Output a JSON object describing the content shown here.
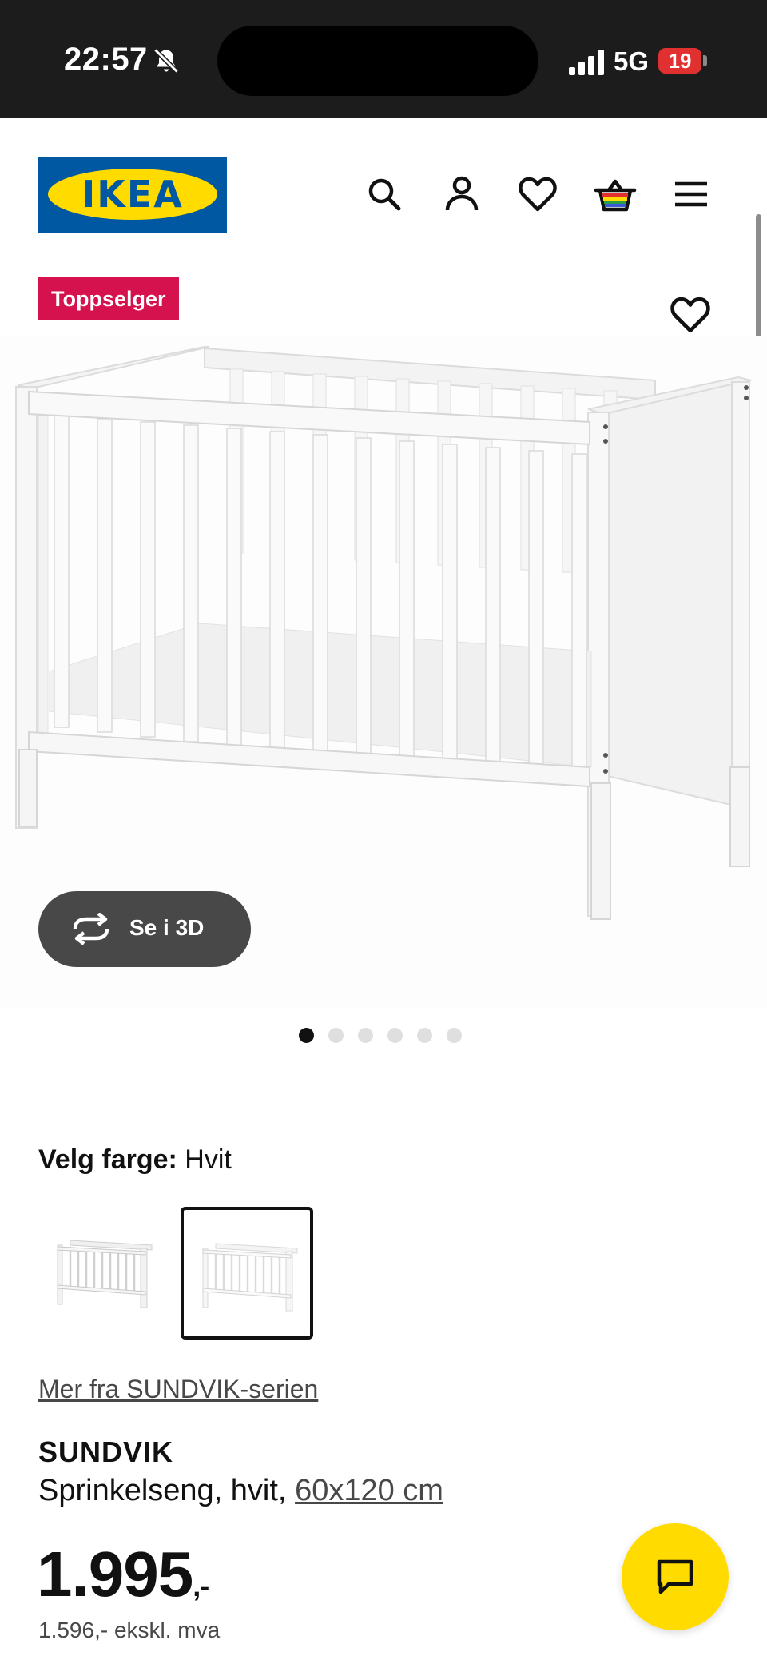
{
  "status_bar": {
    "time": "22:57",
    "network": "5G",
    "battery": "19",
    "icons": [
      "bell-slash-icon",
      "signal-icon"
    ]
  },
  "header": {
    "logo_text": "IKEA",
    "icons": [
      "search-icon",
      "user-icon",
      "heart-icon",
      "cart-icon",
      "menu-icon"
    ]
  },
  "product_image": {
    "badge": "Toppselger",
    "view_3d_label": "Se i 3D",
    "image_count": 6,
    "active_image": 1
  },
  "color": {
    "label": "Velg farge:",
    "value": "Hvit",
    "swatches": 2,
    "selected_swatch": 2
  },
  "product": {
    "series_link": "Mer fra SUNDVIK-serien",
    "name": "SUNDVIK",
    "description": "Sprinkelseng, hvit, ",
    "size": "60x120 cm",
    "price": "1.995",
    "price_suffix": ",-",
    "price_excl_vat": "1.596,- ekskl. mva"
  },
  "colors": {
    "ikea_blue": "#0058a3",
    "ikea_yellow": "#ffdb00",
    "badge_red": "#d6124e",
    "status_bar": "#1c1c1c"
  }
}
